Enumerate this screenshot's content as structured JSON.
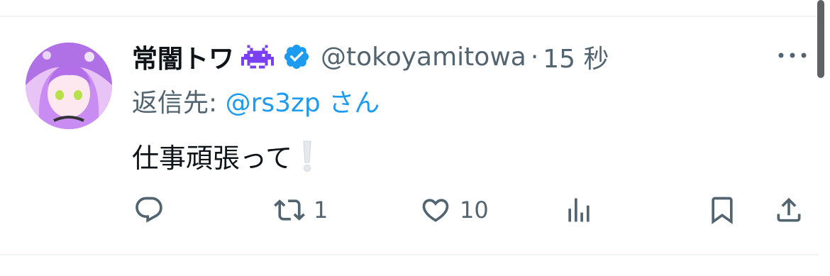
{
  "tweet": {
    "display_name": "常闇トワ",
    "name_emoji": "purple-invader-emoji",
    "verified_icon": "verified-badge-icon",
    "handle": "@tokoyamitowa",
    "separator": "·",
    "time": "15 秒",
    "reply_prefix": "返信先: ",
    "reply_mention": "@rs3zp",
    "reply_suffix": " さん",
    "text": "仕事頑張って",
    "text_emoji": "white-exclamation-emoji"
  },
  "actions": {
    "reply": {
      "icon": "reply-icon",
      "count": ""
    },
    "retweet": {
      "icon": "retweet-icon",
      "count": "1"
    },
    "like": {
      "icon": "heart-icon",
      "count": "10"
    },
    "views": {
      "icon": "views-icon",
      "count": ""
    },
    "bookmark": {
      "icon": "bookmark-icon"
    },
    "share": {
      "icon": "share-icon"
    }
  },
  "colors": {
    "text": "#0f1419",
    "secondary": "#536471",
    "accent": "#1d9bf0",
    "divider": "#eff3f4"
  }
}
